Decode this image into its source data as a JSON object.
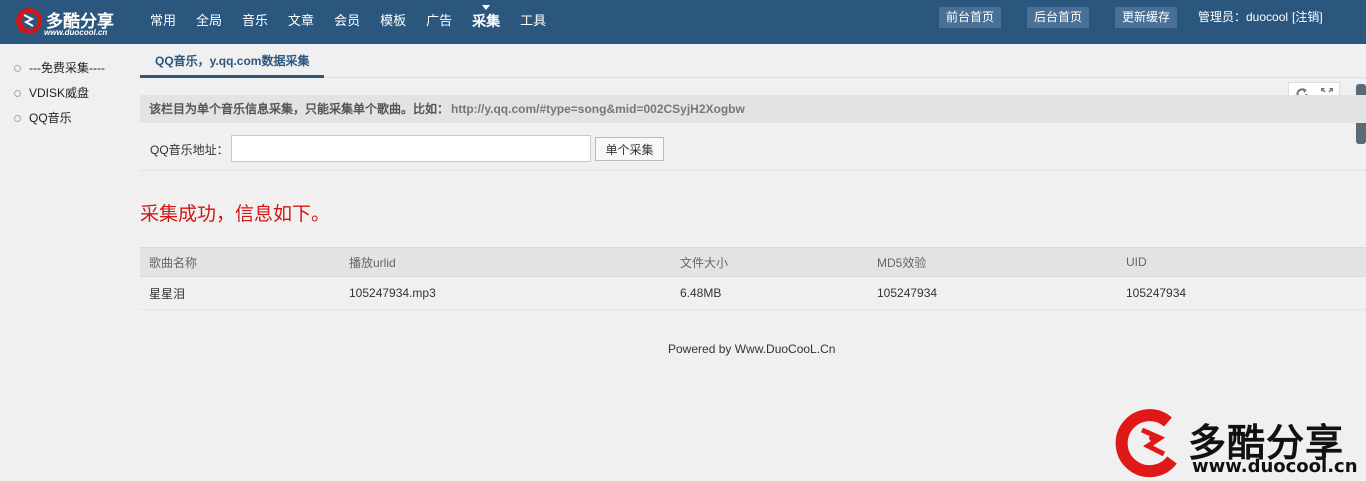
{
  "logo": {
    "name": "多酷分享",
    "url": "www.duocool.cn"
  },
  "nav": {
    "items": [
      {
        "label": "常用"
      },
      {
        "label": "全局"
      },
      {
        "label": "音乐"
      },
      {
        "label": "文章"
      },
      {
        "label": "会员"
      },
      {
        "label": "模板"
      },
      {
        "label": "广告"
      },
      {
        "label": "采集",
        "active": true
      },
      {
        "label": "工具"
      }
    ]
  },
  "top_buttons": {
    "frontend_home": "前台首页",
    "backend_home": "后台首页",
    "update_cache": "更新缓存"
  },
  "admin": {
    "label": "管理员：duocool",
    "logout": "[注销]"
  },
  "sidebar": {
    "items": [
      {
        "label": "---免费采集----"
      },
      {
        "label": "VDISK威盘"
      },
      {
        "label": "QQ音乐"
      }
    ]
  },
  "tab": {
    "label": "QQ音乐，y.qq.com数据采集"
  },
  "description": {
    "text": "该栏目为单个音乐信息采集，只能采集单个歌曲。比如：",
    "example_url": "http://y.qq.com/#type=song&mid=002CSyjH2Xogbw"
  },
  "form": {
    "label": "QQ音乐地址：",
    "value": "",
    "placeholder": "",
    "button": "单个采集"
  },
  "success_message": "采集成功，信息如下。",
  "result_table": {
    "columns": [
      "歌曲名称",
      "播放urlid",
      "文件大小",
      "MD5效验",
      "UID"
    ],
    "rows": [
      [
        "星星泪",
        "105247934.mp3",
        "6.48MB",
        "105247934",
        "105247934"
      ]
    ]
  },
  "footer": "Powered by Www.DuoCooL.Cn",
  "watermark": {
    "name": "多酷分享",
    "url": "www.duocool.cn"
  },
  "colors": {
    "topbar": "#2b567e",
    "top_button": "#4b7096",
    "success": "#d01616",
    "accent": "#2b567e"
  },
  "icons": {
    "logo": "duocool-logo-icon",
    "refresh": "refresh-icon",
    "fullscreen": "fullscreen-icon"
  }
}
